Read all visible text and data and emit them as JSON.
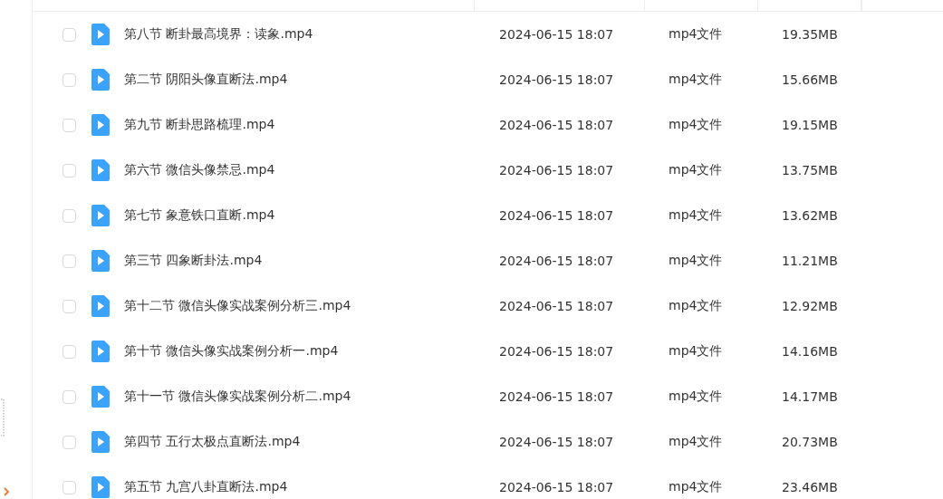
{
  "files": [
    {
      "name": "第八节 断卦最高境界：读象.mp4",
      "modified": "2024-06-15 18:07",
      "type": "mp4文件",
      "size": "19.35MB",
      "checked": false
    },
    {
      "name": "第二节 阴阳头像直断法.mp4",
      "modified": "2024-06-15 18:07",
      "type": "mp4文件",
      "size": "15.66MB",
      "checked": false
    },
    {
      "name": "第九节 断卦思路梳理.mp4",
      "modified": "2024-06-15 18:07",
      "type": "mp4文件",
      "size": "19.15MB",
      "checked": false
    },
    {
      "name": "第六节 微信头像禁忌.mp4",
      "modified": "2024-06-15 18:07",
      "type": "mp4文件",
      "size": "13.75MB",
      "checked": false
    },
    {
      "name": "第七节 象意铁口直断.mp4",
      "modified": "2024-06-15 18:07",
      "type": "mp4文件",
      "size": "13.62MB",
      "checked": false
    },
    {
      "name": "第三节 四象断卦法.mp4",
      "modified": "2024-06-15 18:07",
      "type": "mp4文件",
      "size": "11.21MB",
      "checked": false
    },
    {
      "name": "第十二节 微信头像实战案例分析三.mp4",
      "modified": "2024-06-15 18:07",
      "type": "mp4文件",
      "size": "12.92MB",
      "checked": false
    },
    {
      "name": "第十节 微信头像实战案例分析一.mp4",
      "modified": "2024-06-15 18:07",
      "type": "mp4文件",
      "size": "14.16MB",
      "checked": false
    },
    {
      "name": "第十一节 微信头像实战案例分析二.mp4",
      "modified": "2024-06-15 18:07",
      "type": "mp4文件",
      "size": "14.17MB",
      "checked": false
    },
    {
      "name": "第四节 五行太极点直断法.mp4",
      "modified": "2024-06-15 18:07",
      "type": "mp4文件",
      "size": "20.73MB",
      "checked": false
    },
    {
      "name": "第五节 九宫八卦直断法.mp4",
      "modified": "2024-06-15 18:07",
      "type": "mp4文件",
      "size": "23.46MB",
      "checked": false
    }
  ]
}
